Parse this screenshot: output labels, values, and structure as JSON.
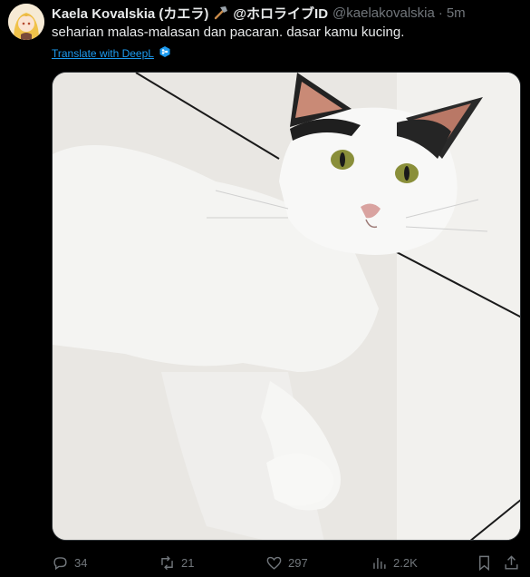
{
  "tweet": {
    "display_name": "Kaela Kovalskia (カエラ)",
    "hammer_icon": "hammer-icon",
    "handle_name": "@ホロライブID",
    "username": "@kaelakovalskia",
    "separator": "·",
    "timestamp": "5m",
    "text": "seharian malas-malasan dan pacaran. dasar kamu kucing.",
    "translate_label": "Translate with DeepL",
    "media_description_icon": "cat-photo"
  },
  "actions": {
    "reply_count": "34",
    "retweet_count": "21",
    "like_count": "297",
    "view_count": "2.2K"
  },
  "colors": {
    "background": "#000000",
    "text": "#e7e9ea",
    "muted": "#71767b",
    "link": "#1d9bf0"
  }
}
